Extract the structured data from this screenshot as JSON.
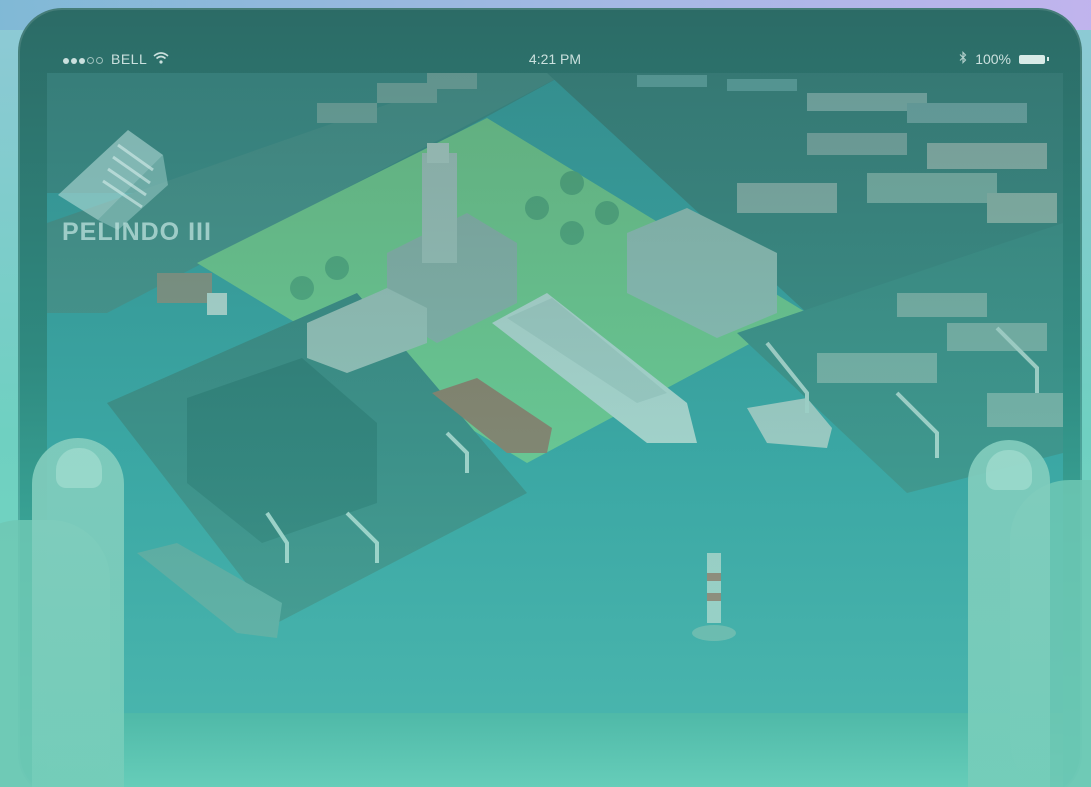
{
  "status_bar": {
    "carrier": "BELL",
    "time": "4:21 PM",
    "battery": "100%"
  },
  "app": {
    "logo_text": "PELINDO III"
  },
  "icons": {
    "signal": "signal-dots-icon",
    "wifi": "wifi-icon",
    "bluetooth": "bluetooth-icon",
    "battery": "battery-icon",
    "logo": "pelindo-logo-icon"
  },
  "colors": {
    "overlay_teal": "#3fb3a3",
    "land_green": "#7fd58a",
    "water": "#3aa6a8"
  }
}
